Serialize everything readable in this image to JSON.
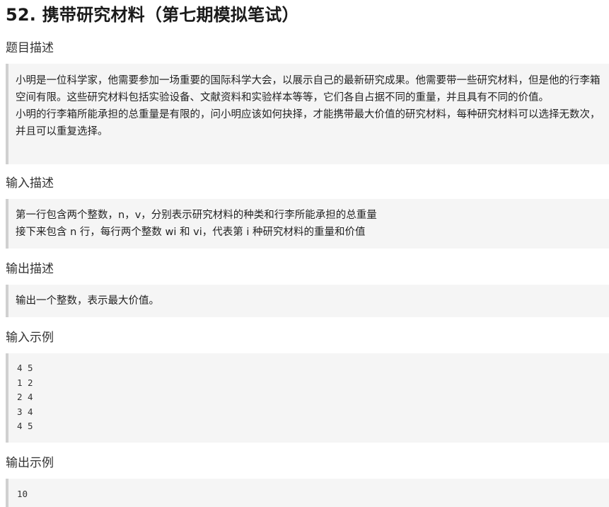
{
  "problem": {
    "title": "52. 携带研究材料（第七期模拟笔试）"
  },
  "sections": {
    "description": {
      "heading": "题目描述",
      "paragraphs": [
        "小明是一位科学家，他需要参加一场重要的国际科学大会，以展示自己的最新研究成果。他需要带一些研究材料，但是他的行李箱空间有限。这些研究材料包括实验设备、文献资料和实验样本等等，它们各自占据不同的重量，并且具有不同的价值。",
        "小明的行李箱所能承担的总重量是有限的，问小明应该如何抉择，才能携带最大价值的研究材料，每种研究材料可以选择无数次，并且可以重复选择。"
      ]
    },
    "input": {
      "heading": "输入描述",
      "lines": [
        "第一行包含两个整数，n，v，分别表示研究材料的种类和行李所能承担的总重量",
        "接下来包含 n 行，每行两个整数 wi 和 vi，代表第 i 种研究材料的重量和价值"
      ]
    },
    "output": {
      "heading": "输出描述",
      "lines": [
        "输出一个整数，表示最大价值。"
      ]
    },
    "input_example": {
      "heading": "输入示例",
      "lines": [
        "4 5",
        "1 2",
        "2 4",
        "3 4",
        "4 5"
      ]
    },
    "output_example": {
      "heading": "输出示例",
      "lines": [
        "10"
      ]
    }
  },
  "colors": {
    "block_background": "#f5f5f5",
    "block_border": "#d0d0d0",
    "title_text": "#1a1a1a",
    "body_text": "#222222"
  }
}
